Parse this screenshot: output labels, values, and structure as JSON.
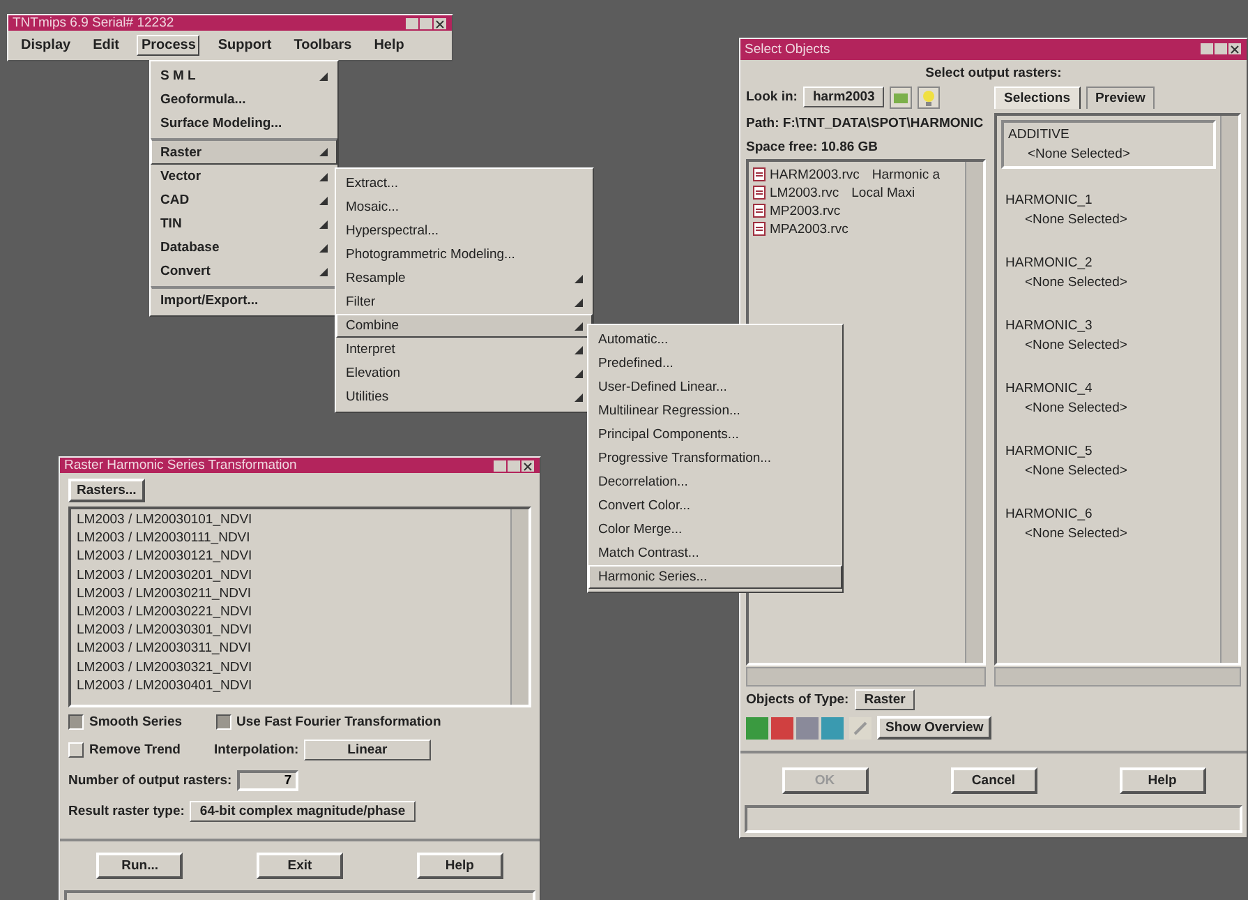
{
  "main_window": {
    "title": "TNTmips 6.9  Serial# 12232",
    "menus": [
      {
        "label": "Display",
        "selected": false
      },
      {
        "label": "Edit",
        "selected": false
      },
      {
        "label": "Process",
        "selected": true
      },
      {
        "label": "Support",
        "selected": false
      },
      {
        "label": "Toolbars",
        "selected": false
      },
      {
        "label": "Help",
        "selected": false
      }
    ]
  },
  "process_menu": {
    "items": [
      {
        "label": "S M L",
        "submenu": true,
        "selected": false,
        "separator_before": false
      },
      {
        "label": "Geoformula...",
        "submenu": false,
        "selected": false,
        "separator_before": false
      },
      {
        "label": "Surface Modeling...",
        "submenu": false,
        "selected": false,
        "separator_before": false
      },
      {
        "label": "Raster",
        "submenu": true,
        "selected": true,
        "separator_before": true
      },
      {
        "label": "Vector",
        "submenu": true,
        "selected": false,
        "separator_before": false
      },
      {
        "label": "CAD",
        "submenu": true,
        "selected": false,
        "separator_before": false
      },
      {
        "label": "TIN",
        "submenu": true,
        "selected": false,
        "separator_before": false
      },
      {
        "label": "Database",
        "submenu": true,
        "selected": false,
        "separator_before": false
      },
      {
        "label": "Convert",
        "submenu": true,
        "selected": false,
        "separator_before": false
      },
      {
        "label": "Import/Export...",
        "submenu": false,
        "selected": false,
        "separator_before": true
      }
    ]
  },
  "raster_submenu": {
    "items": [
      {
        "label": "Extract...",
        "submenu": false,
        "selected": false,
        "separator_before": false
      },
      {
        "label": "Mosaic...",
        "submenu": false,
        "selected": false,
        "separator_before": false
      },
      {
        "label": "Hyperspectral...",
        "submenu": false,
        "selected": false,
        "separator_before": false
      },
      {
        "label": "Photogrammetric Modeling...",
        "submenu": false,
        "selected": false,
        "separator_before": false
      },
      {
        "label": "Resample",
        "submenu": true,
        "selected": false,
        "separator_before": false
      },
      {
        "label": "Filter",
        "submenu": true,
        "selected": false,
        "separator_before": false
      },
      {
        "label": "Combine",
        "submenu": true,
        "selected": true,
        "separator_before": false
      },
      {
        "label": "Interpret",
        "submenu": true,
        "selected": false,
        "separator_before": false
      },
      {
        "label": "Elevation",
        "submenu": true,
        "selected": false,
        "separator_before": false
      },
      {
        "label": "Utilities",
        "submenu": true,
        "selected": false,
        "separator_before": false
      }
    ]
  },
  "combine_submenu": {
    "items": [
      {
        "label": "Automatic...",
        "selected": false
      },
      {
        "label": "Predefined...",
        "selected": false
      },
      {
        "label": "User-Defined Linear...",
        "selected": false
      },
      {
        "label": "Multilinear Regression...",
        "selected": false
      },
      {
        "label": "Principal Components...",
        "selected": false
      },
      {
        "label": "Progressive Transformation...",
        "selected": false
      },
      {
        "label": "Decorrelation...",
        "selected": false
      },
      {
        "label": "Convert Color...",
        "selected": false
      },
      {
        "label": "Color Merge...",
        "selected": false
      },
      {
        "label": "Match Contrast...",
        "selected": false
      },
      {
        "label": "Harmonic Series...",
        "selected": true
      }
    ]
  },
  "select_objects": {
    "title": "Select Objects",
    "prompt": "Select output rasters:",
    "look_in_label": "Look in:",
    "look_in_value": "harm2003",
    "path": "Path: F:\\TNT_DATA\\SPOT\\HARMONIC",
    "space_free": "Space free: 10.86 GB",
    "files": [
      {
        "name": "HARM2003.rvc",
        "description": "Harmonic a"
      },
      {
        "name": "LM2003.rvc",
        "description": "Local Maxi"
      },
      {
        "name": "MP2003.rvc"
      },
      {
        "name": "MPA2003.rvc"
      }
    ],
    "tabs": [
      {
        "label": "Selections",
        "selected": true
      },
      {
        "label": "Preview",
        "selected": false
      }
    ],
    "selections": [
      {
        "name": "ADDITIVE",
        "value": "<None Selected>",
        "selected": true
      },
      {
        "name": "HARMONIC_1",
        "value": "<None Selected>",
        "selected": false
      },
      {
        "name": "HARMONIC_2",
        "value": "<None Selected>",
        "selected": false
      },
      {
        "name": "HARMONIC_3",
        "value": "<None Selected>",
        "selected": false
      },
      {
        "name": "HARMONIC_4",
        "value": "<None Selected>",
        "selected": false
      },
      {
        "name": "HARMONIC_5",
        "value": "<None Selected>",
        "selected": false
      },
      {
        "name": "HARMONIC_6",
        "value": "<None Selected>",
        "selected": false
      }
    ],
    "object_type_label": "Objects of Type:",
    "object_type_value": "Raster",
    "overview_button": "Show Overview",
    "buttons": [
      {
        "label": "OK",
        "disabled": true
      },
      {
        "label": "Cancel",
        "disabled": false
      },
      {
        "label": "Help",
        "disabled": false
      }
    ]
  },
  "harmonic_window": {
    "title": "Raster Harmonic Series Transformation",
    "rasters_button": "Rasters...",
    "rasters": [
      "LM2003 / LM20030101_NDVI",
      "LM2003 / LM20030111_NDVI",
      "LM2003 / LM20030121_NDVI",
      "LM2003 / LM20030201_NDVI",
      "LM2003 / LM20030211_NDVI",
      "LM2003 / LM20030221_NDVI",
      "LM2003 / LM20030301_NDVI",
      "LM2003 / LM20030311_NDVI",
      "LM2003 / LM20030321_NDVI",
      "LM2003 / LM20030401_NDVI"
    ],
    "smooth_series": {
      "label": "Smooth Series",
      "checked": true
    },
    "use_fft": {
      "label": "Use Fast Fourier Transformation",
      "checked": true
    },
    "remove_trend": {
      "label": "Remove Trend",
      "checked": false
    },
    "interpolation_label": "Interpolation:",
    "interpolation_value": "Linear",
    "output_count_label": "Number of output rasters:",
    "output_count": "7",
    "result_type_label": "Result raster type:",
    "result_type_value": "64-bit complex magnitude/phase",
    "buttons": [
      "Run...",
      "Exit",
      "Help"
    ]
  }
}
